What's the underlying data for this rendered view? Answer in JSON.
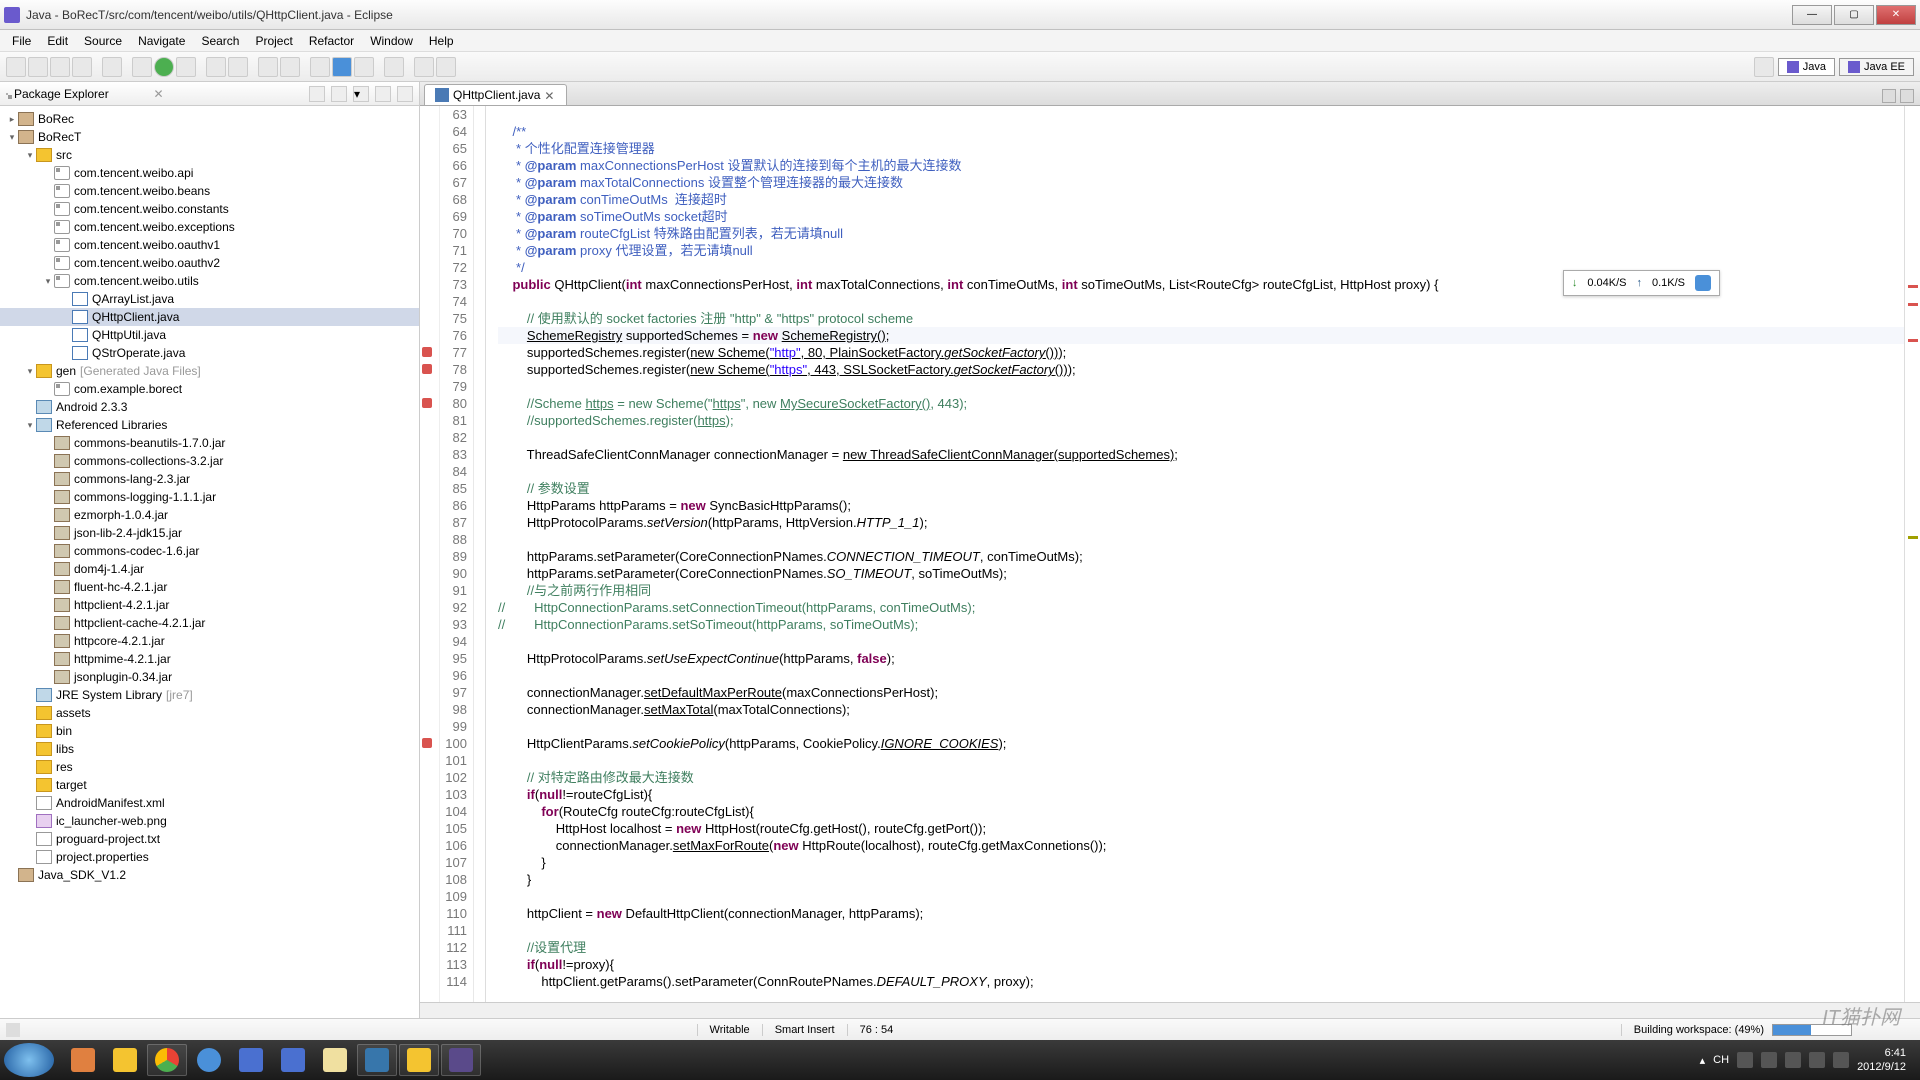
{
  "window": {
    "title": "Java - BoRecT/src/com/tencent/weibo/utils/QHttpClient.java - Eclipse"
  },
  "menu": [
    "File",
    "Edit",
    "Source",
    "Navigate",
    "Search",
    "Project",
    "Refactor",
    "Window",
    "Help"
  ],
  "perspectives": {
    "java": "Java",
    "javaee": "Java EE"
  },
  "pkgExplorer": {
    "title": "Package Explorer",
    "tree": [
      {
        "d": 0,
        "a": "▸",
        "i": "proj",
        "t": "BoRec"
      },
      {
        "d": 0,
        "a": "▾",
        "i": "proj",
        "t": "BoRecT"
      },
      {
        "d": 1,
        "a": "▾",
        "i": "folder",
        "t": "src"
      },
      {
        "d": 2,
        "a": "",
        "i": "pkg",
        "t": "com.tencent.weibo.api"
      },
      {
        "d": 2,
        "a": "",
        "i": "pkg",
        "t": "com.tencent.weibo.beans"
      },
      {
        "d": 2,
        "a": "",
        "i": "pkg",
        "t": "com.tencent.weibo.constants"
      },
      {
        "d": 2,
        "a": "",
        "i": "pkg",
        "t": "com.tencent.weibo.exceptions"
      },
      {
        "d": 2,
        "a": "",
        "i": "pkg",
        "t": "com.tencent.weibo.oauthv1"
      },
      {
        "d": 2,
        "a": "",
        "i": "pkg",
        "t": "com.tencent.weibo.oauthv2"
      },
      {
        "d": 2,
        "a": "▾",
        "i": "pkg",
        "t": "com.tencent.weibo.utils"
      },
      {
        "d": 3,
        "a": "",
        "i": "java",
        "t": "QArrayList.java"
      },
      {
        "d": 3,
        "a": "",
        "i": "java",
        "t": "QHttpClient.java",
        "sel": true
      },
      {
        "d": 3,
        "a": "",
        "i": "java",
        "t": "QHttpUtil.java"
      },
      {
        "d": 3,
        "a": "",
        "i": "java",
        "t": "QStrOperate.java"
      },
      {
        "d": 1,
        "a": "▾",
        "i": "folder",
        "t": "gen",
        "sfx": "[Generated Java Files]"
      },
      {
        "d": 2,
        "a": "",
        "i": "pkg",
        "t": "com.example.borect"
      },
      {
        "d": 1,
        "a": "",
        "i": "lib",
        "t": "Android 2.3.3"
      },
      {
        "d": 1,
        "a": "▾",
        "i": "lib",
        "t": "Referenced Libraries"
      },
      {
        "d": 2,
        "a": "",
        "i": "jar",
        "t": "commons-beanutils-1.7.0.jar"
      },
      {
        "d": 2,
        "a": "",
        "i": "jar",
        "t": "commons-collections-3.2.jar"
      },
      {
        "d": 2,
        "a": "",
        "i": "jar",
        "t": "commons-lang-2.3.jar"
      },
      {
        "d": 2,
        "a": "",
        "i": "jar",
        "t": "commons-logging-1.1.1.jar"
      },
      {
        "d": 2,
        "a": "",
        "i": "jar",
        "t": "ezmorph-1.0.4.jar"
      },
      {
        "d": 2,
        "a": "",
        "i": "jar",
        "t": "json-lib-2.4-jdk15.jar"
      },
      {
        "d": 2,
        "a": "",
        "i": "jar",
        "t": "commons-codec-1.6.jar"
      },
      {
        "d": 2,
        "a": "",
        "i": "jar",
        "t": "dom4j-1.4.jar"
      },
      {
        "d": 2,
        "a": "",
        "i": "jar",
        "t": "fluent-hc-4.2.1.jar"
      },
      {
        "d": 2,
        "a": "",
        "i": "jar",
        "t": "httpclient-4.2.1.jar"
      },
      {
        "d": 2,
        "a": "",
        "i": "jar",
        "t": "httpclient-cache-4.2.1.jar"
      },
      {
        "d": 2,
        "a": "",
        "i": "jar",
        "t": "httpcore-4.2.1.jar"
      },
      {
        "d": 2,
        "a": "",
        "i": "jar",
        "t": "httpmime-4.2.1.jar"
      },
      {
        "d": 2,
        "a": "",
        "i": "jar",
        "t": "jsonplugin-0.34.jar"
      },
      {
        "d": 1,
        "a": "",
        "i": "lib",
        "t": "JRE System Library",
        "sfx": "[jre7]"
      },
      {
        "d": 1,
        "a": "",
        "i": "folder",
        "t": "assets"
      },
      {
        "d": 1,
        "a": "",
        "i": "folder",
        "t": "bin"
      },
      {
        "d": 1,
        "a": "",
        "i": "folder",
        "t": "libs"
      },
      {
        "d": 1,
        "a": "",
        "i": "folder",
        "t": "res"
      },
      {
        "d": 1,
        "a": "",
        "i": "folder",
        "t": "target"
      },
      {
        "d": 1,
        "a": "",
        "i": "file",
        "t": "AndroidManifest.xml"
      },
      {
        "d": 1,
        "a": "",
        "i": "img",
        "t": "ic_launcher-web.png"
      },
      {
        "d": 1,
        "a": "",
        "i": "file",
        "t": "proguard-project.txt"
      },
      {
        "d": 1,
        "a": "",
        "i": "file",
        "t": "project.properties"
      },
      {
        "d": 0,
        "a": "",
        "i": "proj",
        "t": "Java_SDK_V1.2"
      }
    ]
  },
  "editor": {
    "tab": "QHttpClient.java",
    "startLine": 63,
    "lines": [
      {
        "hl": false,
        "mk": "",
        "h": ""
      },
      {
        "hl": false,
        "mk": "",
        "h": "    <span class='c-doc'>/**</span>"
      },
      {
        "hl": false,
        "mk": "",
        "h": "<span class='c-doc'>     * 个性化配置连接管理器</span>"
      },
      {
        "hl": false,
        "mk": "",
        "h": "<span class='c-doc'>     * <b>@param</b> maxConnectionsPerHost 设置默认的连接到每个主机的最大连接数</span>"
      },
      {
        "hl": false,
        "mk": "",
        "h": "<span class='c-doc'>     * <b>@param</b> maxTotalConnections 设置整个管理连接器的最大连接数</span>"
      },
      {
        "hl": false,
        "mk": "",
        "h": "<span class='c-doc'>     * <b>@param</b> conTimeOutMs  连接超时</span>"
      },
      {
        "hl": false,
        "mk": "",
        "h": "<span class='c-doc'>     * <b>@param</b> soTimeOutMs socket超时</span>"
      },
      {
        "hl": false,
        "mk": "",
        "h": "<span class='c-doc'>     * <b>@param</b> routeCfgList 特殊路由配置列表，若无请填null</span>"
      },
      {
        "hl": false,
        "mk": "",
        "h": "<span class='c-doc'>     * <b>@param</b> proxy 代理设置，若无请填null</span>"
      },
      {
        "hl": false,
        "mk": "",
        "h": "<span class='c-doc'>     */</span>"
      },
      {
        "hl": false,
        "mk": "",
        "h": "    <span class='c-kw'>public</span> QHttpClient(<span class='c-kw'>int</span> maxConnectionsPerHost, <span class='c-kw'>int</span> maxTotalConnections, <span class='c-kw'>int</span> conTimeOutMs, <span class='c-kw'>int</span> soTimeOutMs, List&lt;RouteCfg&gt; routeCfgList, HttpHost proxy) {"
      },
      {
        "hl": false,
        "mk": "",
        "h": ""
      },
      {
        "hl": false,
        "mk": "",
        "h": "        <span class='c-comment'>// 使用默认的 socket factories 注册 \"http\" &amp; \"https\" protocol scheme</span>"
      },
      {
        "hl": true,
        "mk": "",
        "h": "        <span class='c-under'>SchemeRegistry</span> supportedSchemes = <span class='c-kw'>new</span> <span class='c-under'>SchemeRegistry()</span>;"
      },
      {
        "hl": false,
        "mk": "err",
        "h": "        supportedSchemes.register(<span class='c-under'>new Scheme(<span class='c-str'>\"http\"</span>, 80, PlainSocketFactory.<span class='c-static'>getSocketFactory</span>())</span>);"
      },
      {
        "hl": false,
        "mk": "err",
        "h": "        supportedSchemes.register(<span class='c-under'>new Scheme(<span class='c-str'>\"https\"</span>, 443, SSLSocketFactory.<span class='c-static'>getSocketFactory</span>())</span>);"
      },
      {
        "hl": false,
        "mk": "",
        "h": ""
      },
      {
        "hl": false,
        "mk": "err",
        "h": "        <span class='c-comment'>//Scheme <span class='c-under'>https</span> = new Scheme(\"<span class='c-under'>https</span>\", new <span class='c-under'>MySecureSocketFactory()</span>, 443);</span>"
      },
      {
        "hl": false,
        "mk": "",
        "h": "        <span class='c-comment'>//supportedSchemes.register(<span class='c-under'>https</span>);</span>"
      },
      {
        "hl": false,
        "mk": "",
        "h": ""
      },
      {
        "hl": false,
        "mk": "",
        "h": "        ThreadSafeClientConnManager connectionManager = <span class='c-under'>new ThreadSafeClientConnManager(supportedSchemes)</span>;"
      },
      {
        "hl": false,
        "mk": "",
        "h": ""
      },
      {
        "hl": false,
        "mk": "",
        "h": "        <span class='c-comment'>// 参数设置</span>"
      },
      {
        "hl": false,
        "mk": "",
        "h": "        HttpParams httpParams = <span class='c-kw'>new</span> SyncBasicHttpParams();"
      },
      {
        "hl": false,
        "mk": "",
        "h": "        HttpProtocolParams.<span class='c-static'>setVersion</span>(httpParams, HttpVersion.<span class='c-static'>HTTP_1_1</span>);"
      },
      {
        "hl": false,
        "mk": "",
        "h": ""
      },
      {
        "hl": false,
        "mk": "",
        "h": "        httpParams.setParameter(CoreConnectionPNames.<span class='c-static'>CONNECTION_TIMEOUT</span>, conTimeOutMs);"
      },
      {
        "hl": false,
        "mk": "",
        "h": "        httpParams.setParameter(CoreConnectionPNames.<span class='c-static'>SO_TIMEOUT</span>, soTimeOutMs);"
      },
      {
        "hl": false,
        "mk": "",
        "h": "        <span class='c-comment'>//与之前两行作用相同</span>"
      },
      {
        "hl": false,
        "mk": "",
        "h": "<span class='c-comment'>//        HttpConnectionParams.setConnectionTimeout(httpParams, conTimeOutMs);</span>"
      },
      {
        "hl": false,
        "mk": "",
        "h": "<span class='c-comment'>//        HttpConnectionParams.setSoTimeout(httpParams, soTimeOutMs);</span>"
      },
      {
        "hl": false,
        "mk": "",
        "h": ""
      },
      {
        "hl": false,
        "mk": "",
        "h": "        HttpProtocolParams.<span class='c-static'>setUseExpectContinue</span>(httpParams, <span class='c-kw'>false</span>);"
      },
      {
        "hl": false,
        "mk": "",
        "h": ""
      },
      {
        "hl": false,
        "mk": "",
        "h": "        connectionManager.<span class='c-under'>setDefaultMaxPerRoute</span>(maxConnectionsPerHost);"
      },
      {
        "hl": false,
        "mk": "",
        "h": "        connectionManager.<span class='c-under'>setMaxTotal</span>(maxTotalConnections);"
      },
      {
        "hl": false,
        "mk": "",
        "h": ""
      },
      {
        "hl": false,
        "mk": "err",
        "h": "        HttpClientParams.<span class='c-static'>setCookiePolicy</span>(httpParams, CookiePolicy.<span class='c-under c-static'>IGNORE_COOKIES</span>);"
      },
      {
        "hl": false,
        "mk": "",
        "h": ""
      },
      {
        "hl": false,
        "mk": "",
        "h": "        <span class='c-comment'>// 对特定路由修改最大连接数</span>"
      },
      {
        "hl": false,
        "mk": "",
        "h": "        <span class='c-kw'>if</span>(<span class='c-kw'>null</span>!=routeCfgList){"
      },
      {
        "hl": false,
        "mk": "",
        "h": "            <span class='c-kw'>for</span>(RouteCfg routeCfg:routeCfgList){"
      },
      {
        "hl": false,
        "mk": "",
        "h": "                HttpHost localhost = <span class='c-kw'>new</span> HttpHost(routeCfg.getHost(), routeCfg.getPort());"
      },
      {
        "hl": false,
        "mk": "",
        "h": "                connectionManager.<span class='c-under'>setMaxForRoute</span>(<span class='c-kw'>new</span> HttpRoute(localhost), routeCfg.getMaxConnetions());"
      },
      {
        "hl": false,
        "mk": "",
        "h": "            }"
      },
      {
        "hl": false,
        "mk": "",
        "h": "        }"
      },
      {
        "hl": false,
        "mk": "",
        "h": ""
      },
      {
        "hl": false,
        "mk": "",
        "h": "        httpClient = <span class='c-kw'>new</span> DefaultHttpClient(connectionManager, httpParams);"
      },
      {
        "hl": false,
        "mk": "",
        "h": ""
      },
      {
        "hl": false,
        "mk": "",
        "h": "        <span class='c-comment'>//设置代理</span>"
      },
      {
        "hl": false,
        "mk": "",
        "h": "        <span class='c-kw'>if</span>(<span class='c-kw'>null</span>!=proxy){"
      },
      {
        "hl": false,
        "mk": "",
        "h": "            httpClient.getParams().setParameter(ConnRoutePNames.<span class='c-static'>DEFAULT_PROXY</span>, proxy);"
      }
    ]
  },
  "netWidget": {
    "down": "0.04K/S",
    "up": "0.1K/S"
  },
  "status": {
    "writable": "Writable",
    "insert": "Smart Insert",
    "pos": "76 : 54",
    "build": "Building workspace: (49%)",
    "prog": 49
  },
  "tray": {
    "ime": "CH",
    "time": "6:41",
    "date": "2012/9/12"
  },
  "watermark": "IT猫扑网"
}
